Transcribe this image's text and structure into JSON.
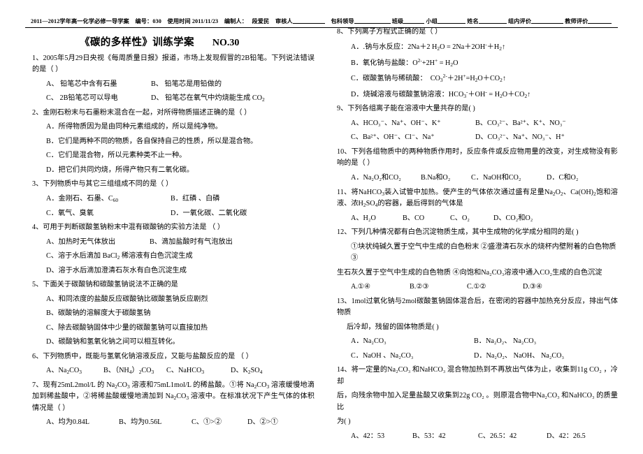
{
  "header": {
    "line": "2011—2012学年高一化学必修一导学案",
    "number_label": "编号：",
    "number_value": "030",
    "use_time_label": "使用时间",
    "use_time_value": "2011/11/23",
    "author_label": "编制人：",
    "author_value": "段爱民",
    "reviewer_label": "审核人",
    "leader_label": "包科领导",
    "class_label": "班级",
    "group_label": "小组",
    "name_label": "姓名",
    "group_eval_label": "组内评价",
    "teacher_eval_label": "教师评价"
  },
  "title": {
    "main": "《碳的多样性》训练学案",
    "no": "NO.30"
  },
  "questions": {
    "q1": {
      "stem": "1、2005年5月29日央视《每周质量日报》报道，市场上发现假冒的2B铅笔。下列说法错误的是（      ）",
      "a": "A、  铅笔芯中含有石墨",
      "b": "B、  铅笔芯是用铅做的",
      "c": "C、  2B铅笔芯可以导电",
      "d_pre": "D、  铅笔芯在氧气中灼烧能生成 CO",
      "d_sub": "2"
    },
    "q2": {
      "stem": "2、金刚石粉末与石墨粉末混合在一起，对所得物质描述正确的是（   ）",
      "a": "A．所得物质因为是由同种元素组成的，所以是纯净物。",
      "b": "B．它们是两种不同的物质，各自保持自己的性质，所以是混合物。",
      "c": "C．它们是混合物，所以元素种类不止一种。",
      "d": "D．把它们共同灼烧，所得产物只有二氧化碳。"
    },
    "q3": {
      "stem": "3、下列物质中与其它三组组成不同的是（      ）",
      "a_pre": "A．金刚石、石墨、C",
      "a_sub": "60",
      "b": "B．红磷 、白磷",
      "c": "C．氧气、臭氧",
      "d": "D．一氧化碳、二氧化碳"
    },
    "q4": {
      "stem": "4、可用于判断碳酸氢钠粉末中混有碳酸钠的实验方法是     （     ）",
      "a": "A、加热时无气体放出",
      "b": "B、滴加盐酸时有气泡放出",
      "c_pre": "C、溶于水后滴加 BaCl",
      "c_sub": "2",
      "c_post": " 稀溶液有白色沉淀生成",
      "d": "D、溶于水后滴加澄清石灰水有白色沉淀生成"
    },
    "q5": {
      "stem": "5、下面关于碳酸钠和碳酸氢钠说法不正确的是",
      "a": "A、和同浓度的盐酸反应碳酸钠比碳酸氢钠反应剧烈",
      "b": "B、碳酸钠的溶解度大于碳酸氢钠",
      "c": "C、除去碳酸钠固体中少量的碳酸氢钠可以直接加热",
      "d": "D、碳酸钠和氢氧化钠之间可以相互转化。"
    },
    "q6": {
      "stem": "6、下列物质中，既能与氢氧化钠溶液反应，又能与盐酸反应的是     （    ）",
      "a_pre": "A、Na",
      "a_sub1": "2",
      "a_mid": "CO",
      "a_sub2": "3",
      "b_pre": "B、（NH",
      "b_sub1": "4",
      "b_mid": "）",
      "b_sub2": "2",
      "b_mid2": "CO",
      "b_sub3": "3",
      "c_pre": "C、NaHCO",
      "c_sub": "3",
      "d_pre": "D、K",
      "d_sub1": "2",
      "d_mid": "SO",
      "d_sub2": "4"
    },
    "q7": {
      "stem_1": "7、现有25mL2mol/L 的 Na",
      "stem_sub1": "2",
      "stem_2": "CO",
      "stem_sub2": "3",
      "stem_3": " 溶液和75mL1mol/L 的稀盐酸。①将 Na",
      "stem_sub3": "2",
      "stem_4": "CO",
      "stem_sub4": "3",
      "stem_5": " 溶液缓慢地滴加到稀盐酸中，②将稀盐酸缓慢地滴加到 Na",
      "stem_sub5": "2",
      "stem_6": "CO",
      "stem_sub6": "3",
      "stem_7": " 溶液中。在标准状况下产生气体的体积情况是（    ）",
      "a": "A、均为0.84L",
      "b": "B、均为0.56L",
      "c": "C、①>②",
      "d": "D、②>①"
    },
    "q8": {
      "stem": "8、下列离子方程式正确的是（      ）",
      "a_text": "A．.钠与水反应：",
      "a_eq_1": "2Na＋2 H",
      "a_eq_sub1": "2",
      "a_eq_2": "O = 2Na＋2OH",
      "a_eq_sup1": "-",
      "a_eq_3": "＋H",
      "a_eq_sub2": "2",
      "a_eq_4": "↑",
      "b_text": "B．氧化钠与盐酸：",
      "b_eq_1": "O",
      "b_eq_sup1": "2-",
      "b_eq_2": "+2H",
      "b_eq_sup2": "+",
      "b_eq_3": " = H",
      "b_eq_sub1": "2",
      "b_eq_4": "O",
      "c_text": "C．碳酸氢钠与稀硫酸：",
      "c_eq_1": "CO",
      "c_eq_sub1": "3",
      "c_eq_sup1": "2-",
      "c_eq_2": "＋2H",
      "c_eq_sup2": "+",
      "c_eq_3": "=H",
      "c_eq_sub2": "2",
      "c_eq_4": "O＋CO",
      "c_eq_sub3": "2",
      "c_eq_5": "↑",
      "d_text": "D．烧碱溶液与碳酸氢钠溶液：",
      "d_eq_1": "HCO",
      "d_eq_sub1": "3",
      "d_eq_sup1": "-",
      "d_eq_2": "＋OH",
      "d_eq_sup2": "-",
      "d_eq_3": " = H",
      "d_eq_sub2": "2",
      "d_eq_4": "O＋CO",
      "d_eq_sub3": "2",
      "d_eq_5": "↑"
    },
    "q9": {
      "stem": "9、下列各组离子能在溶液中大量共存的是(        )",
      "a": "A、HCO₃⁻、Na⁺、OH⁻、K⁺",
      "b": "B、CO₃²⁻、Ba²⁺、K⁺、NO₃⁻",
      "c": "C、Ba²⁺、OH⁻、Cl⁻、Na⁺",
      "d": "D、CO₃²⁻、Na⁺、NO₃⁻、H⁺"
    },
    "q10": {
      "stem": "10、下列各组物质中的两种物质作用时，反应条件或反应物用量的改变，对生成物没有影响的是（    ）",
      "a": "A．Na₂O₂和CO₂",
      "b": "B.Na和O₂",
      "c": "C．NaOH和CO₂",
      "d": "D．C和O₂"
    },
    "q11": {
      "stem_1": "11、将NaHCO",
      "stem_sub1": "3",
      "stem_2": "装入试管中加热。使产生的气体依次通过盛有足量Na",
      "stem_sub2": "2",
      "stem_3": "O",
      "stem_sub3": "2",
      "stem_4": "、Ca(OH)",
      "stem_sub4": "2",
      "stem_5": "饱和溶液、浓H",
      "stem_sub5": "2",
      "stem_6": "SO",
      "stem_sub6": "4",
      "stem_7": "的容器，最后得到的气体是",
      "a": "A、H₂O",
      "b": "B、CO",
      "c": "C、O₂",
      "d": "D、CO₂和O₂"
    },
    "q12": {
      "stem": "12、下列几种情况都有白色沉淀物质生成，其中生成物的化学成分相同的是(   )",
      "items_1": "①块状纯碱久置于空气中生成的白色粉末  ②盛澄清石灰水的烧杯内壁附着的白色物质  ③",
      "items_2": "生石灰久置于空气中生成的白色物质  ④向饱和Na₂CO₃溶液中通入CO₂生成的白色沉淀",
      "a": "A.①④",
      "b": "B.②③",
      "c": "C.①②",
      "d": "D.③④"
    },
    "q13": {
      "stem_1": "13、1mol过氧化钠与2mol碳酸氢钠固体混合后，在密闭的容器中加热充分反应，排出气体物质",
      "stem_2": "后冷却，残留的固体物质是(    )",
      "a": "A．Na₂CO₃",
      "b": "B．Na₂O₂、  Na₂CO₃",
      "c": "C．NaOH 、Na₂CO₃",
      "d": "D．Na₂O₂、  NaOH、  Na₂CO₃"
    },
    "q14": {
      "stem_1": "14、将一定量的Na₂CO₃ 和NaHCO₃ 混合物加热到不再放出气体为止，收集到11g CO₂ ，冷却",
      "stem_2": "后，向残余物中加入足量盐酸又收集到22g CO₂ 。则原混合物中Na₂CO₃ 和NaHCO₃ 的质量比",
      "stem_3": "为(    )",
      "a": "A、42：53",
      "b": "B、53：42",
      "c": "C、26.5：42",
      "d": "D、42：26.5"
    }
  }
}
